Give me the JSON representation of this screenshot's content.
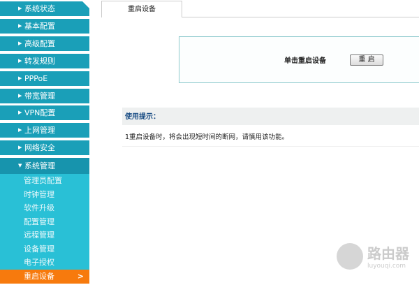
{
  "sidebar": {
    "menu": [
      "系统状态",
      "基本配置",
      "高级配置",
      "转发规则",
      "PPPoE",
      "带宽管理",
      "VPN配置",
      "上网管理",
      "网络安全"
    ],
    "expanded": "系统管理",
    "submenu": [
      "管理员配置",
      "时钟管理",
      "软件升级",
      "配置管理",
      "远程管理",
      "设备管理",
      "电子授权"
    ],
    "active": "重启设备"
  },
  "tab": "重启设备",
  "reboot": {
    "label": "单击重启设备",
    "button": "重 启"
  },
  "tips": {
    "title": "使用提示：",
    "text": "1重启设备时，将会出现短时间的断网，请慎用该功能。"
  },
  "watermark": {
    "name": "路由器",
    "url": "luyouqi.com"
  },
  "colors": {
    "menu": "#1a9fb8",
    "submenu": "#29c0d6",
    "active": "#f77a0d"
  }
}
